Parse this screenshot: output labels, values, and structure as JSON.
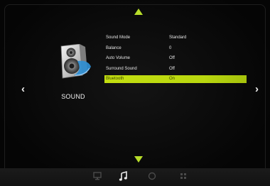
{
  "sidebar": {
    "section_title": "SOUND",
    "section_icon": "speaker-icon"
  },
  "nav": {
    "up_icon": "triangle-up-icon",
    "down_icon": "triangle-down-icon",
    "prev_symbol": "‹",
    "next_symbol": "›"
  },
  "menu": {
    "items": [
      {
        "label": "Sound Mode",
        "value": "Standard",
        "selected": false
      },
      {
        "label": "Balance",
        "value": "0",
        "selected": false
      },
      {
        "label": "Auto Volume",
        "value": "Off",
        "selected": false
      },
      {
        "label": "Surround Sound",
        "value": "Off",
        "selected": false
      },
      {
        "label": "Bluetooth",
        "value": "On",
        "selected": true
      }
    ]
  },
  "bottom_tabs": [
    {
      "name": "picture",
      "icon": "monitor-icon",
      "active": false
    },
    {
      "name": "sound",
      "icon": "music-note-icon",
      "active": true
    },
    {
      "name": "time",
      "icon": "clock-icon",
      "active": false
    },
    {
      "name": "settings",
      "icon": "grid-icon",
      "active": false
    }
  ],
  "colors": {
    "accent": "#c3df10",
    "background": "#0b0b0b",
    "text": "#e6e6e6"
  }
}
